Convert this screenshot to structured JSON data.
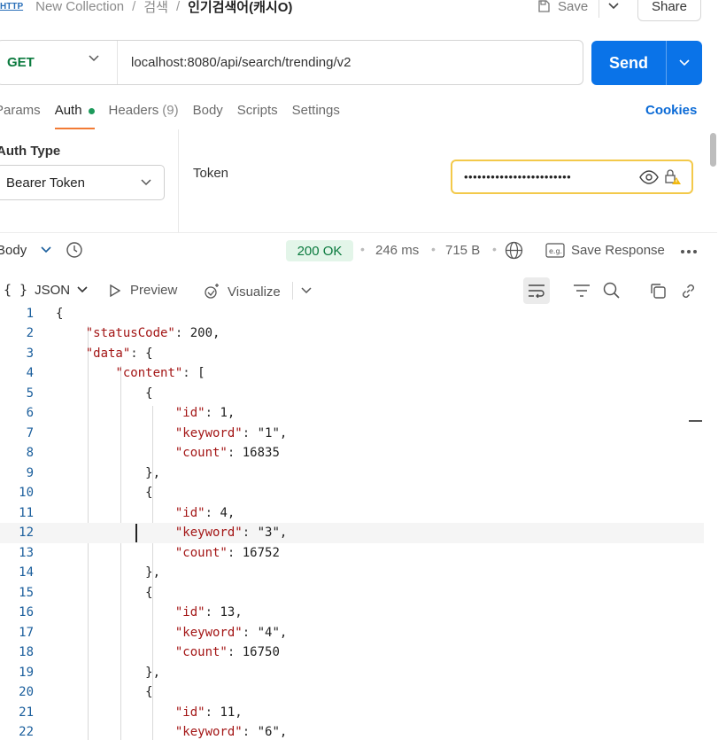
{
  "breadcrumb": {
    "badge": "HTTP",
    "items": [
      "New Collection",
      "검색",
      "인기검색어(캐시O)"
    ],
    "separator": "/"
  },
  "header": {
    "save_label": "Save",
    "share_label": "Share"
  },
  "request": {
    "method": "GET",
    "url": "localhost:8080/api/search/trending/v2",
    "send_label": "Send"
  },
  "tabs": [
    {
      "label": "Params",
      "active": false
    },
    {
      "label": "Auth",
      "active": true,
      "dot": true
    },
    {
      "label": "Headers",
      "count": "(9)",
      "active": false
    },
    {
      "label": "Body",
      "active": false
    },
    {
      "label": "Scripts",
      "active": false
    },
    {
      "label": "Settings",
      "active": false
    }
  ],
  "cookies_label": "Cookies",
  "auth": {
    "type_label": "Auth Type",
    "type_value": "Bearer Token",
    "token_label": "Token",
    "token_value": "••••••••••••••••••••••••"
  },
  "response": {
    "body_label": "Body",
    "status": "200 OK",
    "time": "246 ms",
    "size": "715 B",
    "save_response_label": "Save Response",
    "format": "JSON",
    "preview_label": "Preview",
    "visualize_label": "Visualize"
  },
  "code_lines": [
    {
      "n": "1",
      "t": "{"
    },
    {
      "n": "2",
      "t": "    \"statusCode\": 200,"
    },
    {
      "n": "3",
      "t": "    \"data\": {"
    },
    {
      "n": "4",
      "t": "        \"content\": ["
    },
    {
      "n": "5",
      "t": "            {"
    },
    {
      "n": "6",
      "t": "                \"id\": 1,"
    },
    {
      "n": "7",
      "t": "                \"keyword\": \"1\","
    },
    {
      "n": "8",
      "t": "                \"count\": 16835"
    },
    {
      "n": "9",
      "t": "            },"
    },
    {
      "n": "10",
      "t": "            {"
    },
    {
      "n": "11",
      "t": "                \"id\": 4,"
    },
    {
      "n": "12",
      "t": "                \"keyword\": \"3\","
    },
    {
      "n": "13",
      "t": "                \"count\": 16752"
    },
    {
      "n": "14",
      "t": "            },"
    },
    {
      "n": "15",
      "t": "            {"
    },
    {
      "n": "16",
      "t": "                \"id\": 13,"
    },
    {
      "n": "17",
      "t": "                \"keyword\": \"4\","
    },
    {
      "n": "18",
      "t": "                \"count\": 16750"
    },
    {
      "n": "19",
      "t": "            },"
    },
    {
      "n": "20",
      "t": "            {"
    },
    {
      "n": "21",
      "t": "                \"id\": 11,"
    },
    {
      "n": "22",
      "t": "                \"keyword\": \"6\","
    }
  ],
  "highlighted_line": "12",
  "colors": {
    "accent": "#0a73e8",
    "tab_underline": "#f27b35",
    "status_ok": "#0b7a3e",
    "token_border": "#f3c94a"
  },
  "icons": [
    "history-icon",
    "globe-icon",
    "example-icon",
    "more-icon",
    "wrap-icon",
    "filter-icon",
    "search-icon",
    "copy-icon",
    "link-icon",
    "eye-icon",
    "lock-warning-icon",
    "play-icon",
    "visualize-icon"
  ]
}
